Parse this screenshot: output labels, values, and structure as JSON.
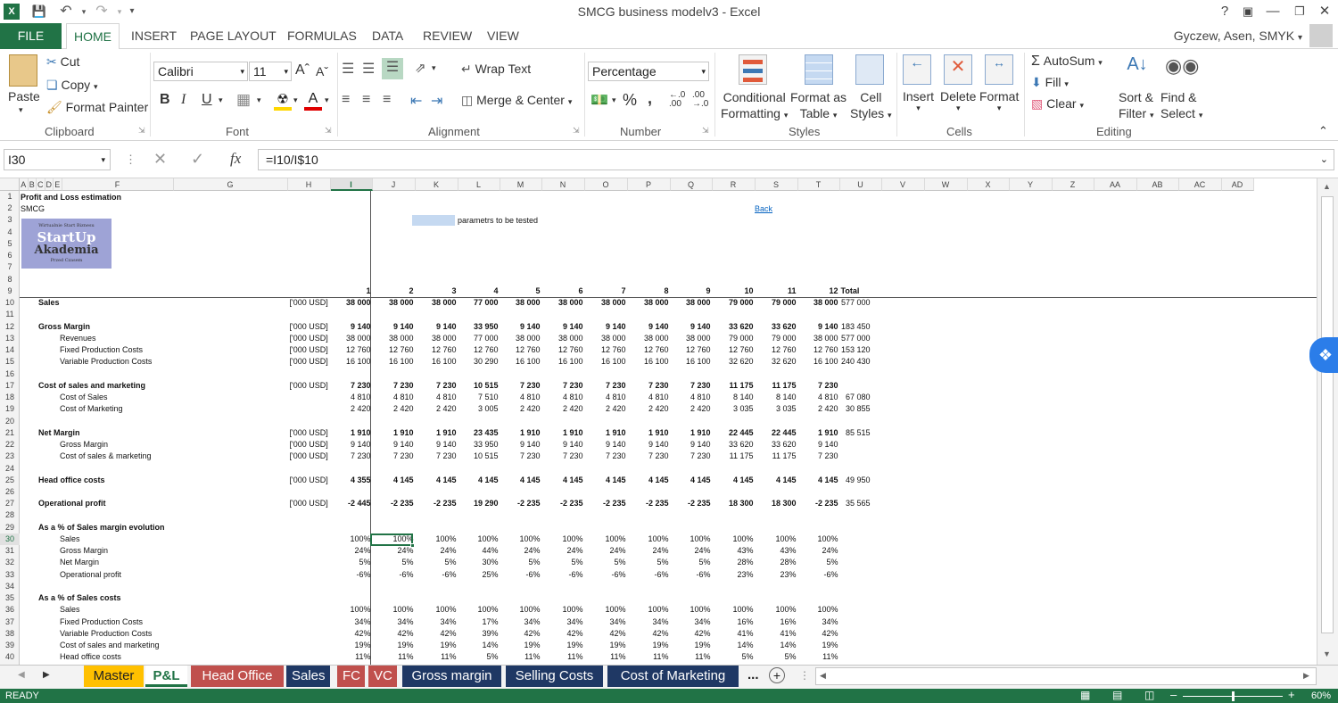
{
  "window": {
    "title": "SMCG business modelv3 - Excel",
    "help": "?",
    "account": "Gyczew, Asen, SMYK"
  },
  "menu": {
    "file": "FILE",
    "tabs": [
      "HOME",
      "INSERT",
      "PAGE LAYOUT",
      "FORMULAS",
      "DATA",
      "REVIEW",
      "VIEW"
    ]
  },
  "ribbon": {
    "clipboard": {
      "paste": "Paste",
      "cut": "Cut",
      "copy": "Copy",
      "format_painter": "Format Painter",
      "label": "Clipboard"
    },
    "font": {
      "name": "Calibri",
      "size": "11",
      "label": "Font",
      "bold": "B",
      "italic": "I",
      "underline": "U"
    },
    "alignment": {
      "wrap": "Wrap Text",
      "merge": "Merge & Center",
      "label": "Alignment"
    },
    "number": {
      "format": "Percentage",
      "label": "Number",
      "percent": "%",
      "comma": ","
    },
    "styles": {
      "conditional": [
        "Conditional",
        "Formatting"
      ],
      "format_table": [
        "Format as",
        "Table"
      ],
      "cell_styles": [
        "Cell",
        "Styles"
      ],
      "label": "Styles"
    },
    "cells": {
      "insert": "Insert",
      "delete": "Delete",
      "format": "Format",
      "label": "Cells"
    },
    "editing": {
      "autosum": "AutoSum",
      "fill": "Fill",
      "clear": "Clear",
      "sort": [
        "Sort &",
        "Filter"
      ],
      "find": [
        "Find &",
        "Select"
      ],
      "label": "Editing"
    }
  },
  "formula_bar": {
    "name_box": "I30",
    "fx": "fx",
    "formula": "=I10/I$10"
  },
  "columns": [
    "A",
    "B",
    "C",
    "D",
    "E",
    "F",
    "G",
    "H",
    "I",
    "J",
    "K",
    "L",
    "M",
    "N",
    "O",
    "P",
    "Q",
    "R",
    "S",
    "T",
    "U",
    "V",
    "W",
    "X",
    "Y",
    "Z",
    "AA",
    "AB",
    "AC",
    "AD"
  ],
  "rows": [
    "1",
    "2",
    "3",
    "4",
    "5",
    "6",
    "7",
    "8",
    "9",
    "10",
    "11",
    "12",
    "13",
    "14",
    "15",
    "16",
    "17",
    "18",
    "19",
    "20",
    "21",
    "22",
    "23",
    "24",
    "25",
    "26",
    "27",
    "28",
    "29",
    "30",
    "31",
    "32",
    "33",
    "34",
    "35",
    "36",
    "37",
    "38",
    "39",
    "40"
  ],
  "sheet": {
    "title": "Profit and Loss estimation",
    "company": "SMCG",
    "back_link": "Back",
    "param_note": "parametrs to be tested",
    "logo": {
      "top_line": "Wirtualnie Start Biznesu",
      "line1": "StartUp",
      "line2": "Akademia",
      "bottom_line": "Przed Czasem"
    },
    "months": [
      "1",
      "2",
      "3",
      "4",
      "5",
      "6",
      "7",
      "8",
      "9",
      "10",
      "11",
      "12"
    ],
    "total_label": "Total",
    "lines": [
      {
        "row": 10,
        "label": "Sales",
        "indent": 1,
        "bold": true,
        "unit": "['000 USD]",
        "values": [
          "38 000",
          "38 000",
          "38 000",
          "77 000",
          "38 000",
          "38 000",
          "38 000",
          "38 000",
          "38 000",
          "79 000",
          "79 000",
          "38 000"
        ],
        "total": "577 000"
      },
      {
        "row": 12,
        "label": "Gross Margin",
        "indent": 1,
        "bold": true,
        "unit": "['000 USD]",
        "values": [
          "9 140",
          "9 140",
          "9 140",
          "33 950",
          "9 140",
          "9 140",
          "9 140",
          "9 140",
          "9 140",
          "33 620",
          "33 620",
          "9 140"
        ],
        "total": "183 450"
      },
      {
        "row": 13,
        "label": "Revenues",
        "indent": 2,
        "bold": false,
        "unit": "['000 USD]",
        "values": [
          "38 000",
          "38 000",
          "38 000",
          "77 000",
          "38 000",
          "38 000",
          "38 000",
          "38 000",
          "38 000",
          "79 000",
          "79 000",
          "38 000"
        ],
        "total": "577 000"
      },
      {
        "row": 14,
        "label": "Fixed Production Costs",
        "indent": 2,
        "bold": false,
        "unit": "['000 USD]",
        "values": [
          "12 760",
          "12 760",
          "12 760",
          "12 760",
          "12 760",
          "12 760",
          "12 760",
          "12 760",
          "12 760",
          "12 760",
          "12 760",
          "12 760"
        ],
        "total": "153 120"
      },
      {
        "row": 15,
        "label": "Variable Production Costs",
        "indent": 2,
        "bold": false,
        "unit": "['000 USD]",
        "values": [
          "16 100",
          "16 100",
          "16 100",
          "30 290",
          "16 100",
          "16 100",
          "16 100",
          "16 100",
          "16 100",
          "32 620",
          "32 620",
          "16 100"
        ],
        "total": "240 430"
      },
      {
        "row": 17,
        "label": "Cost of sales and marketing",
        "indent": 1,
        "bold": true,
        "unit": "['000 USD]",
        "values": [
          "7 230",
          "7 230",
          "7 230",
          "10 515",
          "7 230",
          "7 230",
          "7 230",
          "7 230",
          "7 230",
          "11 175",
          "11 175",
          "7 230"
        ],
        "total": ""
      },
      {
        "row": 18,
        "label": "Cost of Sales",
        "indent": 2,
        "bold": false,
        "unit": "",
        "values": [
          "4 810",
          "4 810",
          "4 810",
          "7 510",
          "4 810",
          "4 810",
          "4 810",
          "4 810",
          "4 810",
          "8 140",
          "8 140",
          "4 810"
        ],
        "total": "67 080"
      },
      {
        "row": 19,
        "label": "Cost of Marketing",
        "indent": 2,
        "bold": false,
        "unit": "",
        "values": [
          "2 420",
          "2 420",
          "2 420",
          "3 005",
          "2 420",
          "2 420",
          "2 420",
          "2 420",
          "2 420",
          "3 035",
          "3 035",
          "2 420"
        ],
        "total": "30 855"
      },
      {
        "row": 21,
        "label": "Net Margin",
        "indent": 1,
        "bold": true,
        "unit": "['000 USD]",
        "values": [
          "1 910",
          "1 910",
          "1 910",
          "23 435",
          "1 910",
          "1 910",
          "1 910",
          "1 910",
          "1 910",
          "22 445",
          "22 445",
          "1 910"
        ],
        "total": "85 515"
      },
      {
        "row": 22,
        "label": "Gross Margin",
        "indent": 2,
        "bold": false,
        "unit": "['000 USD]",
        "values": [
          "9 140",
          "9 140",
          "9 140",
          "33 950",
          "9 140",
          "9 140",
          "9 140",
          "9 140",
          "9 140",
          "33 620",
          "33 620",
          "9 140"
        ],
        "total": ""
      },
      {
        "row": 23,
        "label": "Cost of sales & marketing",
        "indent": 2,
        "bold": false,
        "unit": "['000 USD]",
        "values": [
          "7 230",
          "7 230",
          "7 230",
          "10 515",
          "7 230",
          "7 230",
          "7 230",
          "7 230",
          "7 230",
          "11 175",
          "11 175",
          "7 230"
        ],
        "total": ""
      },
      {
        "row": 25,
        "label": "Head office costs",
        "indent": 1,
        "bold": true,
        "unit": "['000 USD]",
        "values": [
          "4 355",
          "4 145",
          "4 145",
          "4 145",
          "4 145",
          "4 145",
          "4 145",
          "4 145",
          "4 145",
          "4 145",
          "4 145",
          "4 145"
        ],
        "total": "49 950"
      },
      {
        "row": 27,
        "label": "Operational profit",
        "indent": 1,
        "bold": true,
        "unit": "['000 USD]",
        "values": [
          "-2 445",
          "-2 235",
          "-2 235",
          "19 290",
          "-2 235",
          "-2 235",
          "-2 235",
          "-2 235",
          "-2 235",
          "18 300",
          "18 300",
          "-2 235"
        ],
        "total": "35 565"
      },
      {
        "row": 29,
        "label": "As a % of Sales margin evolution",
        "indent": 1,
        "bold": true,
        "unit": "",
        "values": [],
        "total": ""
      },
      {
        "row": 30,
        "label": "Sales",
        "indent": 2,
        "bold": false,
        "unit": "",
        "values": [
          "100%",
          "100%",
          "100%",
          "100%",
          "100%",
          "100%",
          "100%",
          "100%",
          "100%",
          "100%",
          "100%",
          "100%"
        ],
        "total": ""
      },
      {
        "row": 31,
        "label": "Gross Margin",
        "indent": 2,
        "bold": false,
        "unit": "",
        "values": [
          "24%",
          "24%",
          "24%",
          "44%",
          "24%",
          "24%",
          "24%",
          "24%",
          "24%",
          "43%",
          "43%",
          "24%"
        ],
        "total": ""
      },
      {
        "row": 32,
        "label": "Net Margin",
        "indent": 2,
        "bold": false,
        "unit": "",
        "values": [
          "5%",
          "5%",
          "5%",
          "30%",
          "5%",
          "5%",
          "5%",
          "5%",
          "5%",
          "28%",
          "28%",
          "5%"
        ],
        "total": ""
      },
      {
        "row": 33,
        "label": "Operational profit",
        "indent": 2,
        "bold": false,
        "unit": "",
        "values": [
          "-6%",
          "-6%",
          "-6%",
          "25%",
          "-6%",
          "-6%",
          "-6%",
          "-6%",
          "-6%",
          "23%",
          "23%",
          "-6%"
        ],
        "total": ""
      },
      {
        "row": 35,
        "label": "As a % of Sales costs",
        "indent": 1,
        "bold": true,
        "unit": "",
        "values": [],
        "total": ""
      },
      {
        "row": 36,
        "label": "Sales",
        "indent": 2,
        "bold": false,
        "unit": "",
        "values": [
          "100%",
          "100%",
          "100%",
          "100%",
          "100%",
          "100%",
          "100%",
          "100%",
          "100%",
          "100%",
          "100%",
          "100%"
        ],
        "total": ""
      },
      {
        "row": 37,
        "label": "Fixed Production Costs",
        "indent": 2,
        "bold": false,
        "unit": "",
        "values": [
          "34%",
          "34%",
          "34%",
          "17%",
          "34%",
          "34%",
          "34%",
          "34%",
          "34%",
          "16%",
          "16%",
          "34%"
        ],
        "total": ""
      },
      {
        "row": 38,
        "label": "Variable Production Costs",
        "indent": 2,
        "bold": false,
        "unit": "",
        "values": [
          "42%",
          "42%",
          "42%",
          "39%",
          "42%",
          "42%",
          "42%",
          "42%",
          "42%",
          "41%",
          "41%",
          "42%"
        ],
        "total": ""
      },
      {
        "row": 39,
        "label": "Cost of sales and marketing",
        "indent": 2,
        "bold": false,
        "unit": "",
        "values": [
          "19%",
          "19%",
          "19%",
          "14%",
          "19%",
          "19%",
          "19%",
          "19%",
          "19%",
          "14%",
          "14%",
          "19%"
        ],
        "total": ""
      },
      {
        "row": 40,
        "label": "Head office costs",
        "indent": 2,
        "bold": false,
        "unit": "",
        "values": [
          "11%",
          "11%",
          "11%",
          "5%",
          "11%",
          "11%",
          "11%",
          "11%",
          "11%",
          "5%",
          "5%",
          "11%"
        ],
        "total": ""
      }
    ]
  },
  "tabs": [
    {
      "name": "Master",
      "color": "#ffc000",
      "text": "#222222"
    },
    {
      "name": "P&L",
      "color": "#ffffff",
      "text": "#217346",
      "active": true
    },
    {
      "name": "Head Office",
      "color": "#c0504d",
      "text": "#ffffff"
    },
    {
      "name": "Sales",
      "color": "#1f3864",
      "text": "#ffffff"
    },
    {
      "name": "FC",
      "color": "#c0504d",
      "text": "#ffffff"
    },
    {
      "name": "VC",
      "color": "#c0504d",
      "text": "#ffffff"
    },
    {
      "name": "Gross margin",
      "color": "#1f3864",
      "text": "#ffffff"
    },
    {
      "name": "Selling Costs",
      "color": "#1f3864",
      "text": "#ffffff"
    },
    {
      "name": "Cost of Marketing",
      "color": "#1f3864",
      "text": "#ffffff"
    }
  ],
  "tabs_more": "...",
  "status": {
    "ready": "READY",
    "zoom": "60%"
  },
  "colors": {
    "accent": "#217346",
    "param_fill": "#c5d9f1",
    "link": "#0563c1",
    "logo_fill": "#9ea3d6"
  }
}
